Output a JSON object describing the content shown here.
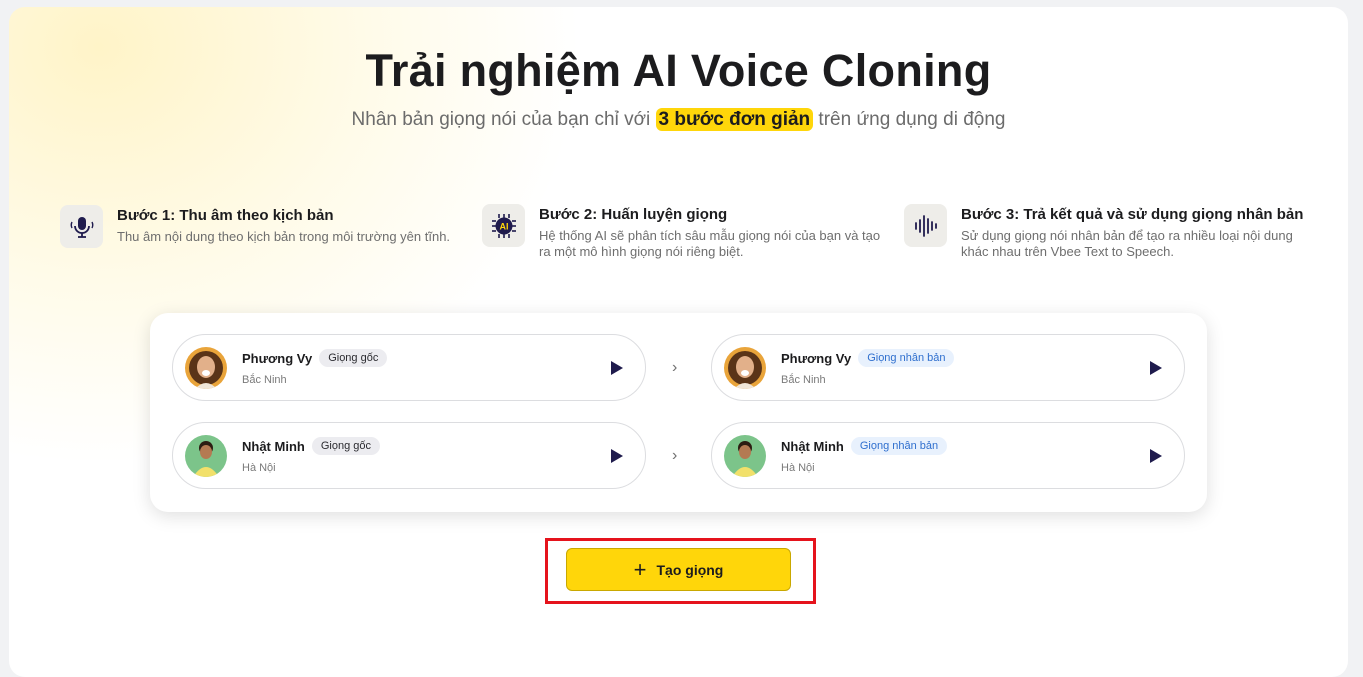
{
  "hero": {
    "title": "Trải nghiệm AI Voice Cloning",
    "subtitle_before": "Nhân bản giọng nói của bạn chỉ với ",
    "subtitle_highlight": "3 bước đơn giản",
    "subtitle_after": " trên ứng dụng di động"
  },
  "steps": [
    {
      "icon": "microphone-icon",
      "title": "Bước 1: Thu âm theo kịch bản",
      "desc_line1": "Thu âm nội dung theo kịch bản trong môi trường yên tĩnh.",
      "desc_line2": ""
    },
    {
      "icon": "ai-chip-icon",
      "title": "Bước 2: Huấn luyện giọng",
      "desc_line1": "Hệ thống AI sẽ phân tích sâu mẫu giọng nói của bạn và tạo",
      "desc_line2": "ra một mô hình giọng nói riêng biệt."
    },
    {
      "icon": "soundwave-icon",
      "title": "Bước 3: Trả kết quả và sử dụng giọng nhân bản",
      "desc_line1": "Sử dụng giọng nói nhân bản để tạo ra nhiều loại nội dung",
      "desc_line2": "khác nhau trên Vbee Text to Speech."
    }
  ],
  "voices": [
    {
      "original": {
        "name": "Phương Vy",
        "badge": "Giọng gốc",
        "location": "Bắc Ninh"
      },
      "clone": {
        "name": "Phương Vy",
        "badge": "Giọng nhân bản",
        "location": "Bắc Ninh"
      }
    },
    {
      "original": {
        "name": "Nhật Minh",
        "badge": "Giọng gốc",
        "location": "Hà Nội"
      },
      "clone": {
        "name": "Nhật Minh",
        "badge": "Giọng nhân bản",
        "location": "Hà Nội"
      }
    }
  ],
  "arrow_glyph": "›",
  "cta": {
    "plus": "+",
    "label": "Tạo giọng"
  },
  "colors": {
    "accent": "#ffd60a",
    "highlight_frame": "#e5131c",
    "clone_badge": "#2f6fce",
    "play": "#1f1b4d"
  }
}
